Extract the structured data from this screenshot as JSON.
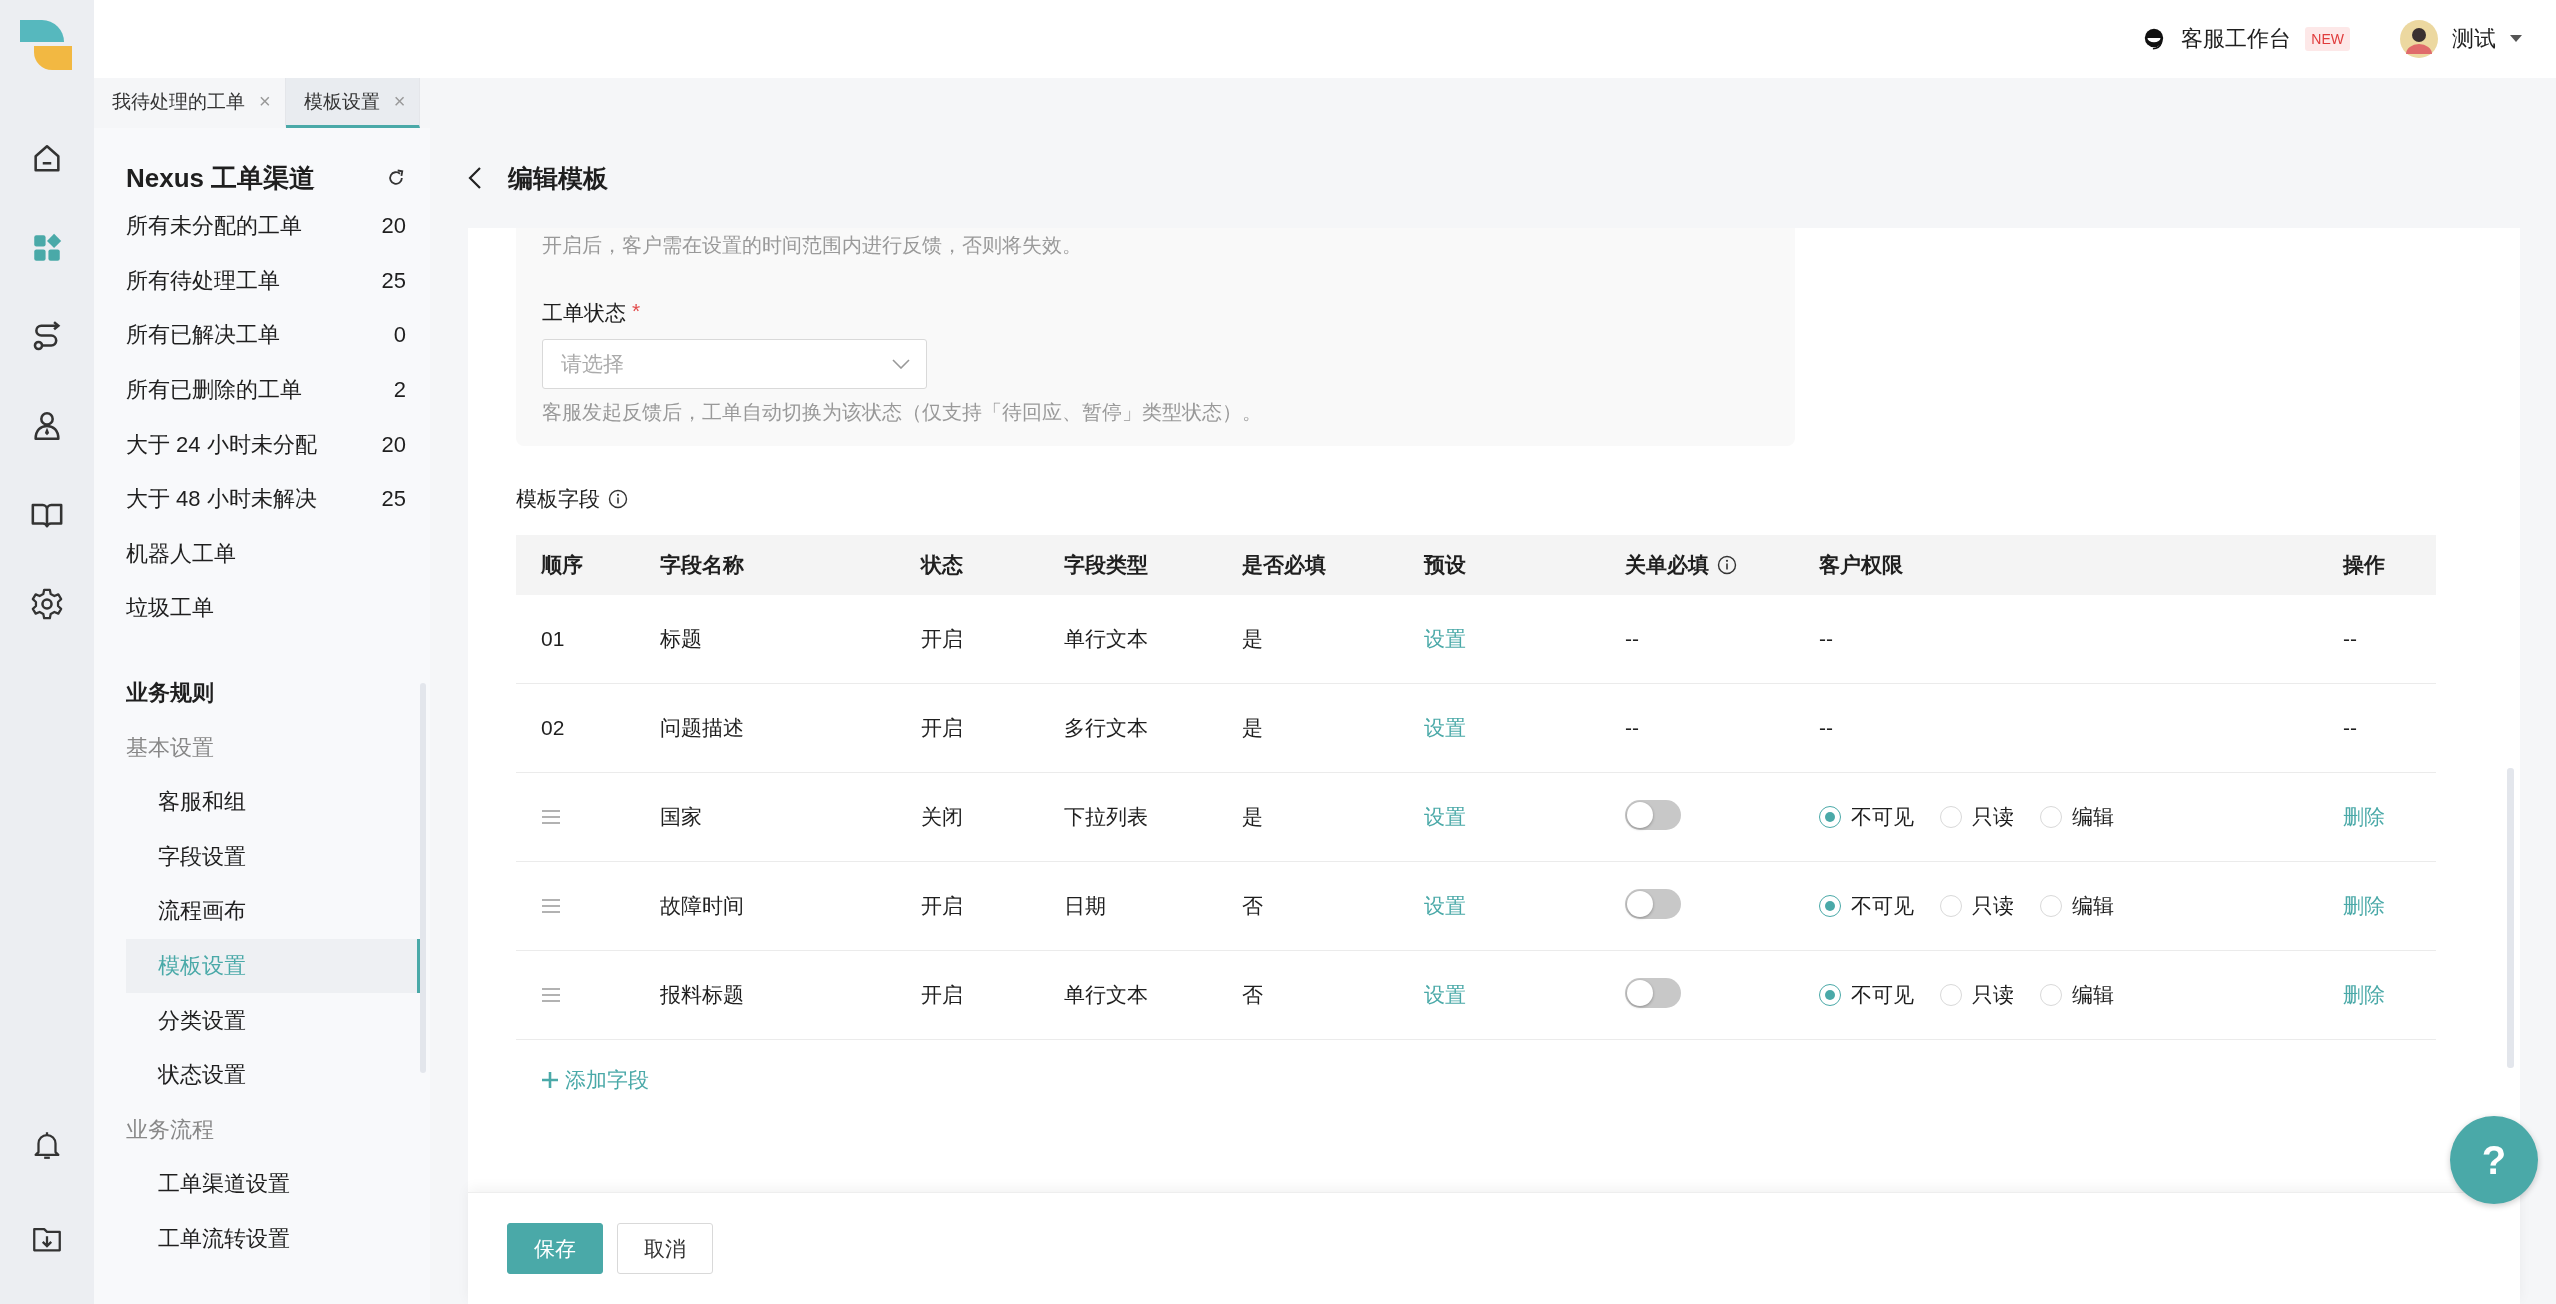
{
  "rail": {
    "main": [
      {
        "selected": false
      },
      {
        "selected": true
      },
      {
        "selected": false
      },
      {
        "selected": false
      },
      {
        "selected": false
      },
      {
        "selected": false
      }
    ],
    "bottom": [
      {
        "selected": false
      },
      {
        "selected": false
      }
    ]
  },
  "topbar": {
    "workbench": "客服工作台",
    "badge": "NEW",
    "user": "测试"
  },
  "tabs": [
    {
      "label": "我待处理的工单",
      "selected": false,
      "close": "×"
    },
    {
      "label": "模板设置",
      "selected": true,
      "close": "×"
    }
  ],
  "sidebar": {
    "title": "Nexus 工单渠道",
    "views": [
      {
        "label": "所有未分配的工单",
        "count": "20"
      },
      {
        "label": "所有待处理工单",
        "count": "25"
      },
      {
        "label": "所有已解决工单",
        "count": "0"
      },
      {
        "label": "所有已删除的工单",
        "count": "2"
      },
      {
        "label": "大于 24 小时未分配",
        "count": "20"
      },
      {
        "label": "大于 48 小时未解决",
        "count": "25"
      },
      {
        "label": "机器人工单"
      },
      {
        "label": "垃圾工单"
      }
    ],
    "section": "业务规则",
    "groups": [
      {
        "title": "基本设置",
        "items": [
          {
            "label": "客服和组",
            "selected": false
          },
          {
            "label": "字段设置",
            "selected": false
          },
          {
            "label": "流程画布",
            "selected": false
          },
          {
            "label": "模板设置",
            "selected": true
          },
          {
            "label": "分类设置",
            "selected": false
          },
          {
            "label": "状态设置",
            "selected": false
          }
        ]
      },
      {
        "title": "业务流程",
        "items": [
          {
            "label": "工单渠道设置",
            "selected": false
          },
          {
            "label": "工单流转设置",
            "selected": false
          }
        ]
      }
    ]
  },
  "editor": {
    "title": "编辑模板",
    "hint_top": "开启后，客户需在设置的时间范围内进行反馈，否则将失效。",
    "status_label": "工单状态",
    "required_mark": "*",
    "status_select": {
      "placeholder": "请选择"
    },
    "status_hint": "客服发起反馈后，工单自动切换为该状态（仅支持「待回应、暂停」类型状态）。",
    "fields_title": "模板字段",
    "table": {
      "columns": [
        {
          "label": "顺序"
        },
        {
          "label": "字段名称"
        },
        {
          "label": "状态"
        },
        {
          "label": "字段类型"
        },
        {
          "label": "是否必填"
        },
        {
          "label": "预设"
        },
        {
          "label": "关单必填",
          "info": true
        },
        {
          "label": "客户权限"
        },
        {
          "label": "操作"
        }
      ],
      "rows": [
        {
          "kind": "fixed",
          "order": "01",
          "name": "标题",
          "status": "开启",
          "type": "单行文本",
          "required": "是",
          "preset": "设置",
          "close_required": "--",
          "permission": "--",
          "action": "--"
        },
        {
          "kind": "fixed",
          "order": "02",
          "name": "问题描述",
          "status": "开启",
          "type": "多行文本",
          "required": "是",
          "preset": "设置",
          "close_required": "--",
          "permission": "--",
          "action": "--"
        },
        {
          "kind": "custom",
          "name": "国家",
          "status": "关闭",
          "type": "下拉列表",
          "required": "是",
          "preset": "设置",
          "close_required_on": false,
          "permission": [
            {
              "label": "不可见",
              "selected": true
            },
            {
              "label": "只读",
              "selected": false
            },
            {
              "label": "编辑",
              "selected": false
            }
          ],
          "action": "删除"
        },
        {
          "kind": "custom",
          "name": "故障时间",
          "status": "开启",
          "type": "日期",
          "required": "否",
          "preset": "设置",
          "close_required_on": false,
          "permission": [
            {
              "label": "不可见",
              "selected": true
            },
            {
              "label": "只读",
              "selected": false
            },
            {
              "label": "编辑",
              "selected": false
            }
          ],
          "action": "删除"
        },
        {
          "kind": "custom",
          "name": "报料标题",
          "status": "开启",
          "type": "单行文本",
          "required": "否",
          "preset": "设置",
          "close_required_on": false,
          "permission": [
            {
              "label": "不可见",
              "selected": true
            },
            {
              "label": "只读",
              "selected": false
            },
            {
              "label": "编辑",
              "selected": false
            }
          ],
          "action": "删除"
        }
      ]
    },
    "add_field": "添加字段",
    "buttons": [
      {
        "label": "保存",
        "kind": "primary"
      },
      {
        "label": "取消",
        "kind": "default"
      }
    ],
    "help": "?"
  }
}
